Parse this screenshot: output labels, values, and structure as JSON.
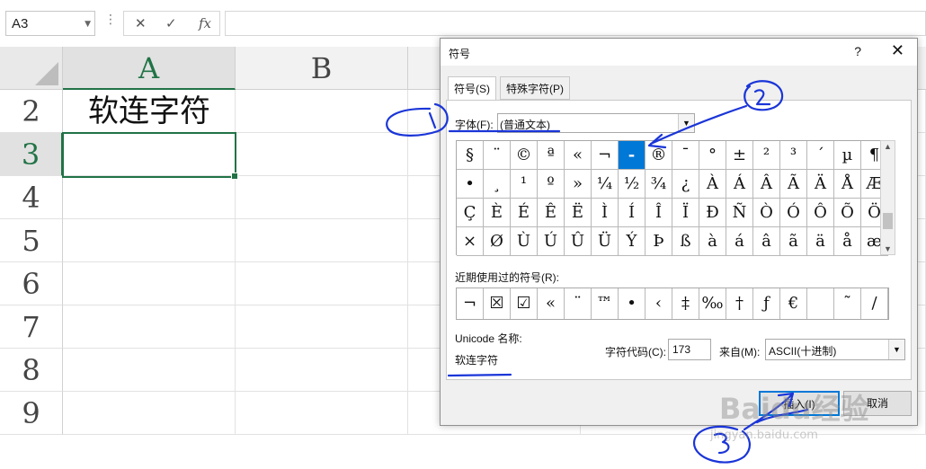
{
  "formula_bar": {
    "name_box": "A3",
    "dots": "⋮",
    "cancel_glyph": "✕",
    "enter_glyph": "✓",
    "fx_label": "fx",
    "formula": ""
  },
  "sheet": {
    "columns": [
      "A",
      "B"
    ],
    "rows": [
      "2",
      "3",
      "4",
      "5",
      "6",
      "7",
      "8",
      "9"
    ],
    "selected_column": "A",
    "selected_row": "3",
    "cell_A2": "软连字符",
    "accent_color": "#217346"
  },
  "dialog": {
    "title": "符号",
    "help": "?",
    "close": "✕",
    "tabs": [
      {
        "label": "符号(S)",
        "active": true
      },
      {
        "label": "特殊字符(P)",
        "active": false
      }
    ],
    "font_label": "字体(F):",
    "font_value": "(普通文本)",
    "symbols": [
      [
        "§",
        "¨",
        "©",
        "ª",
        "«",
        "¬",
        "-",
        "®",
        "¯",
        "°",
        "±",
        "²",
        "³",
        "´",
        "µ",
        "¶"
      ],
      [
        "•",
        "¸",
        "¹",
        "º",
        "»",
        "¼",
        "½",
        "¾",
        "¿",
        "À",
        "Á",
        "Â",
        "Ã",
        "Ä",
        "Å",
        "Æ"
      ],
      [
        "Ç",
        "È",
        "É",
        "Ê",
        "Ë",
        "Ì",
        "Í",
        "Î",
        "Ï",
        "Ð",
        "Ñ",
        "Ò",
        "Ó",
        "Ô",
        "Õ",
        "Ö"
      ],
      [
        "×",
        "Ø",
        "Ù",
        "Ú",
        "Û",
        "Ü",
        "Ý",
        "Þ",
        "ß",
        "à",
        "á",
        "â",
        "ã",
        "ä",
        "å",
        "æ"
      ]
    ],
    "selected_symbol_index": 6,
    "recent_label": "近期使用过的符号(R):",
    "recent_symbols": [
      "¬",
      "☒",
      "☑",
      "«",
      "¨",
      "™",
      "•",
      "‹",
      "‡",
      "‰",
      "†",
      "ƒ",
      "€",
      "",
      "˜",
      "/"
    ],
    "unicode_name_label": "Unicode 名称:",
    "unicode_name_value": "软连字符",
    "char_code_label": "字符代码(C):",
    "char_code_value": "173",
    "from_label": "来自(M):",
    "from_value": "ASCII(十进制)",
    "insert_button": "插入(I)",
    "cancel_button": "取消",
    "selection_color": "#0078d7"
  },
  "annotations": {
    "ink_color": "#1a35d8",
    "marks": [
      "1",
      "2",
      "3"
    ]
  },
  "watermark": {
    "logo_text": "Baidu经验",
    "url_text": "jingyan.baidu.com"
  }
}
